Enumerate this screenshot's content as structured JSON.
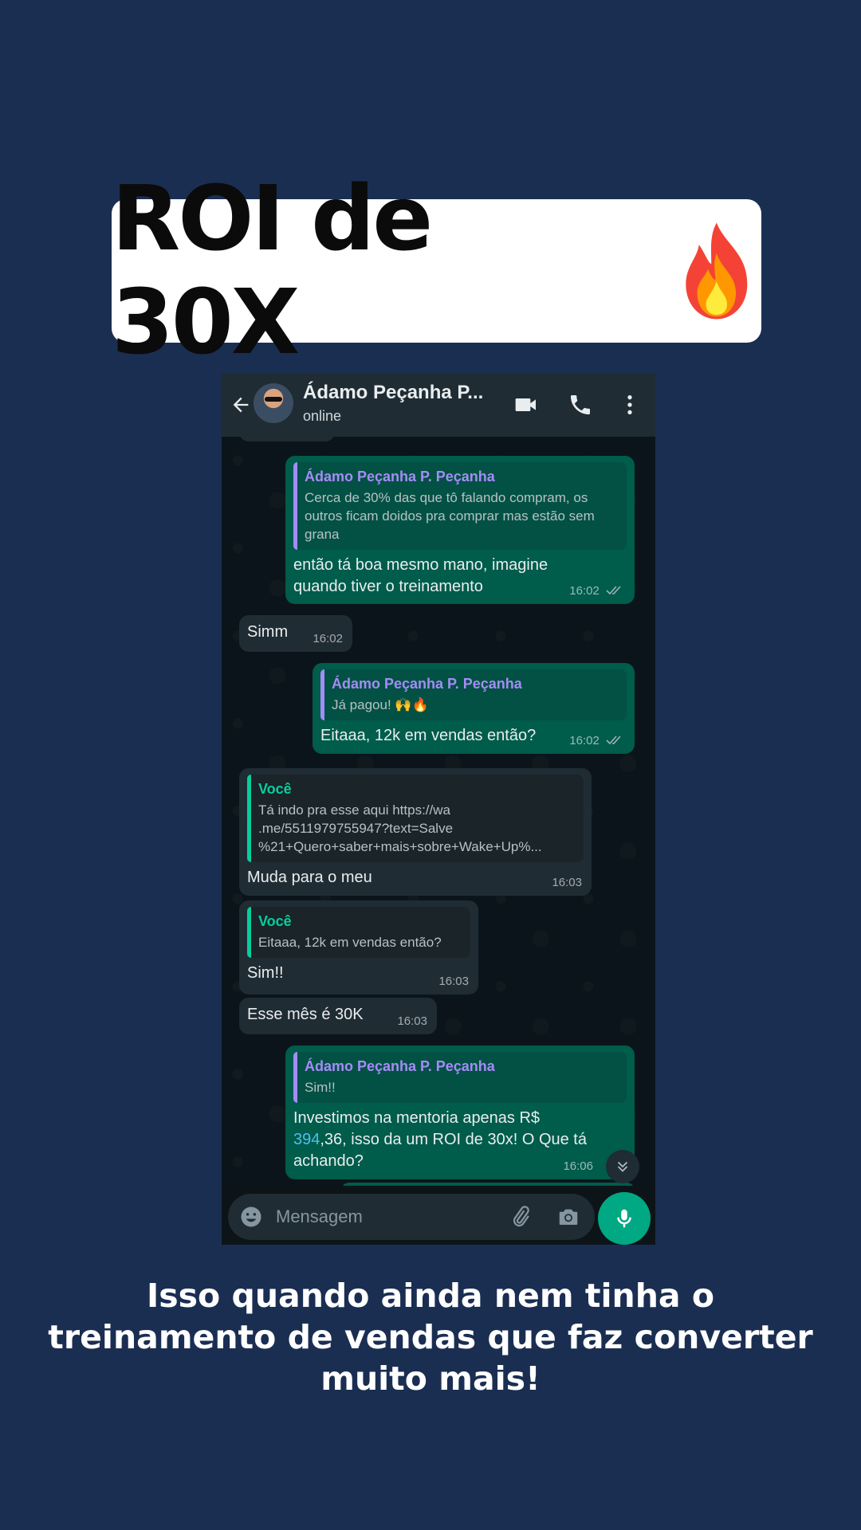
{
  "headline": {
    "text": "ROI de 30X"
  },
  "contact": {
    "name": "Ádamo Peçanha P...",
    "status": "online"
  },
  "messages": [
    {
      "quote_author": "Ádamo Peçanha P. Peçanha",
      "quote_text": "Cerca de 30% das que tô falando compram, os outros ficam doidos pra comprar mas estão sem grana",
      "text": "então tá boa mesmo mano, imagine quando tiver o treinamento",
      "time": "16:02"
    },
    {
      "text": "Simm",
      "time": "16:02"
    },
    {
      "quote_author": "Ádamo Peçanha P. Peçanha",
      "quote_text": "Já pagou! 🙌🔥",
      "text": "Eitaaa, 12k em vendas então?",
      "time": "16:02"
    },
    {
      "quote_author": "Você",
      "quote_text": "Tá indo pra esse aqui https://wa .me/5511979755947?text=Salve %21+Quero+saber+mais+sobre+Wake+Up%...",
      "text": "Muda para o meu",
      "time": "16:03"
    },
    {
      "quote_author": "Você",
      "quote_text": "Eitaaa, 12k em vendas então?",
      "text": "Sim!!",
      "time": "16:03"
    },
    {
      "text": "Esse mês é 30K",
      "time": "16:03"
    },
    {
      "quote_author": "Ádamo Peçanha P. Peçanha",
      "quote_text": "Sim!!",
      "text_pre": "Investimos na mentoria apenas R$ ",
      "text_link": "394",
      "text_post": ",36, isso da um ROI de 30x! O Que tá achando?",
      "time": "16:06"
    }
  ],
  "input": {
    "placeholder": "Mensagem"
  },
  "caption": "Isso quando ainda nem tinha o treinamento de vendas que faz converter muito mais!",
  "colors": {
    "background": "#1a2e52",
    "outgoing": "#005c4b",
    "incoming": "#202c33",
    "accent": "#00a884"
  }
}
